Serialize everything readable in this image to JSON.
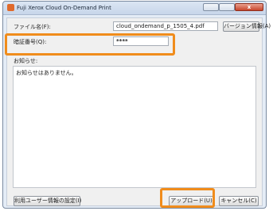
{
  "window": {
    "title": "Fuji Xerox Cloud On-Demand Print",
    "close_label": "x"
  },
  "form": {
    "filename_label": "ファイル名(F):",
    "filename_value": "cloud_ondemand_p_1505_4.pdf",
    "version_button": "バージョン情報(A)",
    "pin_label": "暗証番号(Q):",
    "pin_value": "****",
    "notice_label": "お知らせ:",
    "notice_text": "お知らせはありません。"
  },
  "footer": {
    "user_settings_button": "利用ユーザー情報の設定(I)",
    "upload_button": "アップロード(U)",
    "cancel_button": "キャンセル(C)"
  },
  "colors": {
    "highlight": "#f08c1c"
  }
}
